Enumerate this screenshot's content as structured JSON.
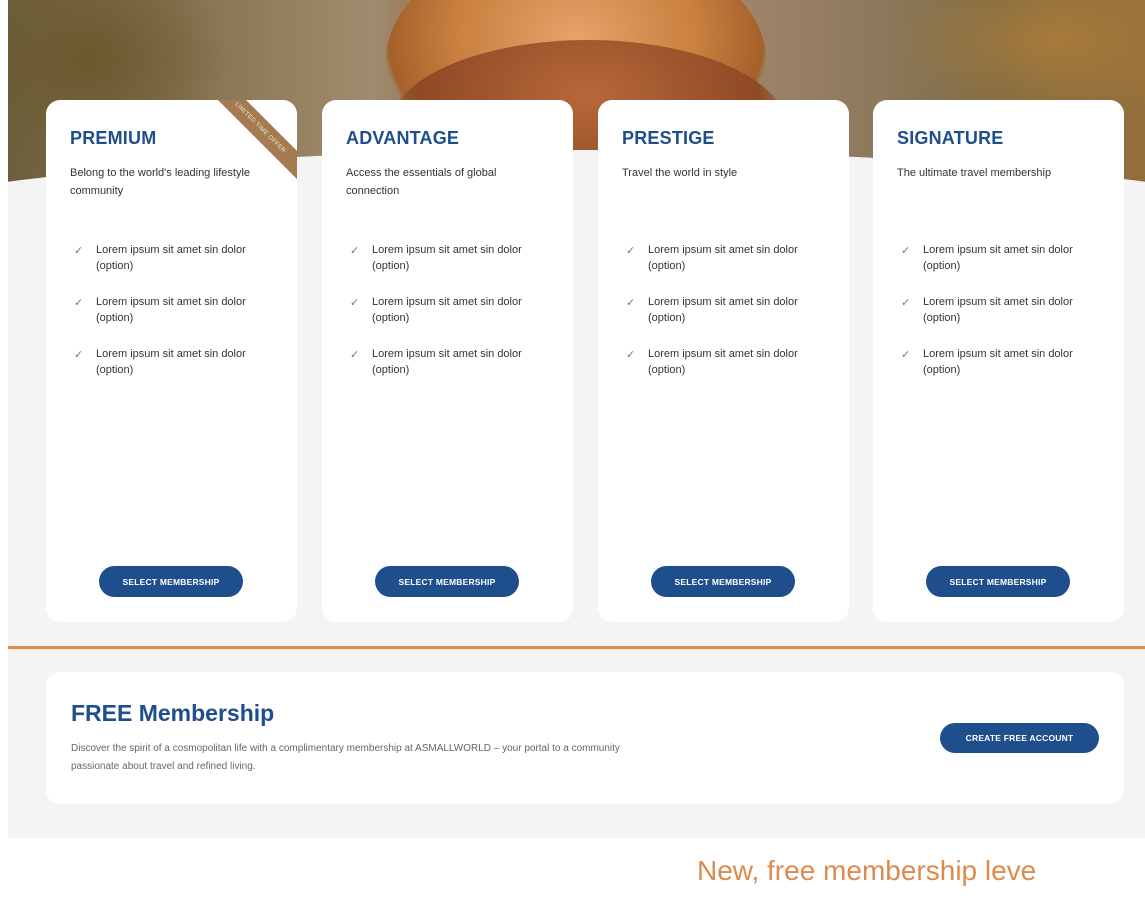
{
  "plans": [
    {
      "title": "PREMIUM",
      "description": "Belong to the world's leading lifestyle community",
      "ribbon": "LIMITED TIME OFFER",
      "features": [
        "Lorem ipsum sit amet sin dolor (option)",
        "Lorem ipsum sit amet sin dolor (option)",
        "Lorem ipsum sit amet sin dolor (option)"
      ],
      "button_label": "SELECT MEMBERSHIP"
    },
    {
      "title": "ADVANTAGE",
      "description": "Access the essentials of global connection",
      "features": [
        "Lorem ipsum sit amet sin dolor (option)",
        "Lorem ipsum sit amet sin dolor (option)",
        "Lorem ipsum sit amet sin dolor (option)"
      ],
      "button_label": "SELECT MEMBERSHIP"
    },
    {
      "title": "PRESTIGE",
      "description": "Travel the world in style",
      "features": [
        "Lorem ipsum sit amet sin dolor (option)",
        "Lorem ipsum sit amet sin dolor (option)",
        "Lorem ipsum sit amet sin dolor (option)"
      ],
      "button_label": "SELECT MEMBERSHIP"
    },
    {
      "title": "SIGNATURE",
      "description": "The ultimate travel membership",
      "features": [
        "Lorem ipsum sit amet sin dolor (option)",
        "Lorem ipsum sit amet sin dolor (option)",
        "Lorem ipsum sit amet sin dolor (option)"
      ],
      "button_label": "SELECT MEMBERSHIP"
    }
  ],
  "check_icon": "✓",
  "free": {
    "title": "FREE Membership",
    "description": "Discover the spirit of a cosmopolitan life with a complimentary membership at ASMALLWORLD – your portal to a community passionate about travel and refined living.",
    "button_label": "CREATE FREE ACCOUNT"
  },
  "caption": "New, free membership leve",
  "colors": {
    "brand": "#1f4e8c",
    "accent": "#e08a4a",
    "ribbon": "#a57c52"
  }
}
